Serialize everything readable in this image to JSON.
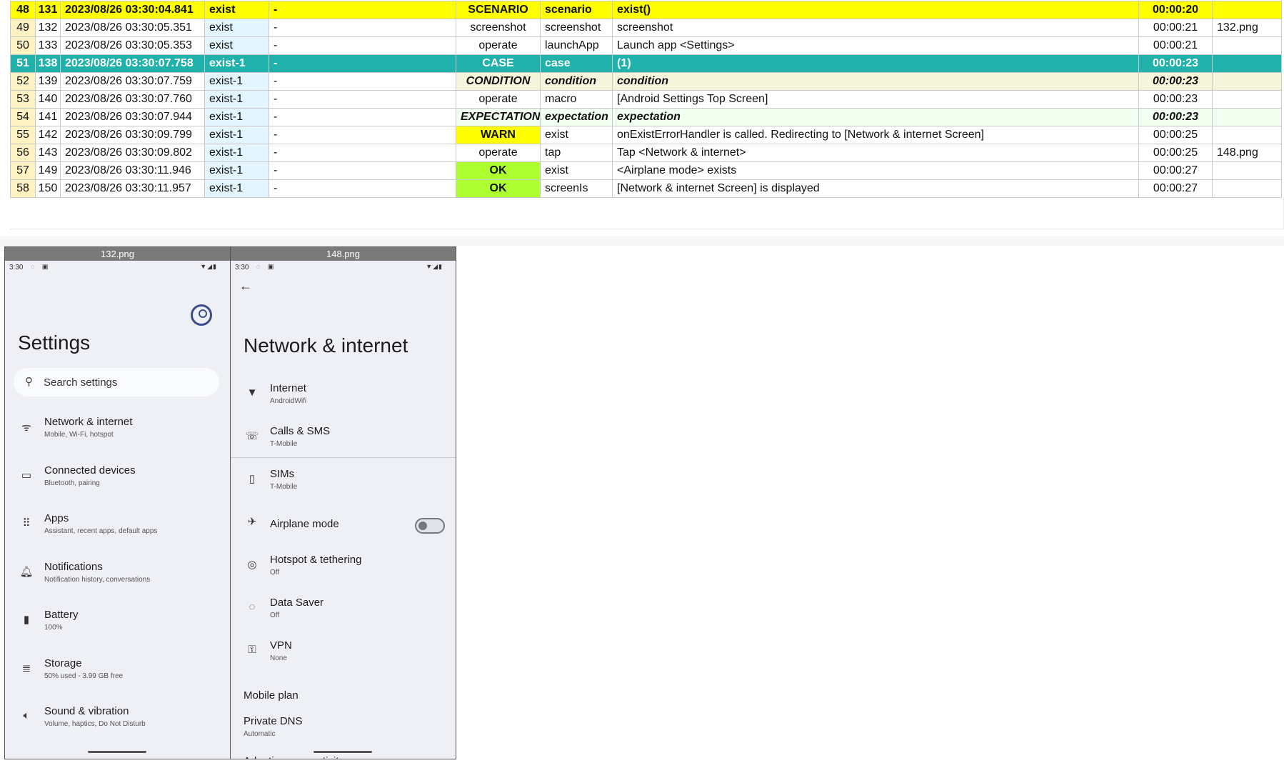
{
  "log_rows": [
    {
      "no": "48",
      "line": "131",
      "ts": "2023/08/26 03:30:04.841",
      "log": "exist",
      "group": "-",
      "type": "SCENARIO",
      "cmd": "scenario",
      "msg": "exist()",
      "time": "00:00:20",
      "file": "",
      "style": "scenario"
    },
    {
      "no": "49",
      "line": "132",
      "ts": "2023/08/26 03:30:05.351",
      "log": "exist",
      "group": "-",
      "type": "screenshot",
      "cmd": "screenshot",
      "msg": "screenshot",
      "time": "00:00:21",
      "file": "132.png",
      "style": ""
    },
    {
      "no": "50",
      "line": "133",
      "ts": "2023/08/26 03:30:05.353",
      "log": "exist",
      "group": "-",
      "type": "operate",
      "cmd": "launchApp",
      "msg": "Launch app <Settings>",
      "time": "00:00:21",
      "file": "",
      "style": ""
    },
    {
      "no": "51",
      "line": "138",
      "ts": "2023/08/26 03:30:07.758",
      "log": "exist-1",
      "group": "-",
      "type": "CASE",
      "cmd": "case",
      "msg": "(1)",
      "time": "00:00:23",
      "file": "",
      "style": "case"
    },
    {
      "no": "52",
      "line": "139",
      "ts": "2023/08/26 03:30:07.759",
      "log": "exist-1",
      "group": "-",
      "type": "CONDITION",
      "cmd": "condition",
      "msg": "condition",
      "time": "00:00:23",
      "file": "",
      "style": "condition"
    },
    {
      "no": "53",
      "line": "140",
      "ts": "2023/08/26 03:30:07.760",
      "log": "exist-1",
      "group": "-",
      "type": "operate",
      "cmd": "macro",
      "msg": "[Android Settings Top Screen]",
      "time": "00:00:23",
      "file": "",
      "style": ""
    },
    {
      "no": "54",
      "line": "141",
      "ts": "2023/08/26 03:30:07.944",
      "log": "exist-1",
      "group": "-",
      "type": "EXPECTATION",
      "cmd": "expectation",
      "msg": "expectation",
      "time": "00:00:23",
      "file": "",
      "style": "expectation"
    },
    {
      "no": "55",
      "line": "142",
      "ts": "2023/08/26 03:30:09.799",
      "log": "exist-1",
      "group": "-",
      "type": "WARN",
      "cmd": "exist",
      "msg": "onExistErrorHandler is called. Redirecting to [Network & internet Screen]",
      "time": "00:00:25",
      "file": "",
      "style": "warn"
    },
    {
      "no": "56",
      "line": "143",
      "ts": "2023/08/26 03:30:09.802",
      "log": "exist-1",
      "group": "-",
      "type": "operate",
      "cmd": "tap",
      "msg": "Tap <Network & internet>",
      "time": "00:00:25",
      "file": "148.png",
      "style": ""
    },
    {
      "no": "57",
      "line": "149",
      "ts": "2023/08/26 03:30:11.946",
      "log": "exist-1",
      "group": "-",
      "type": "OK",
      "cmd": "exist",
      "msg": "<Airplane mode> exists",
      "time": "00:00:27",
      "file": "",
      "style": "ok"
    },
    {
      "no": "58",
      "line": "150",
      "ts": "2023/08/26 03:30:11.957",
      "log": "exist-1",
      "group": "-",
      "type": "OK",
      "cmd": "screenIs",
      "msg": "[Network & internet Screen] is displayed",
      "time": "00:00:27",
      "file": "",
      "style": "ok"
    }
  ],
  "shot1": {
    "caption": "132.png",
    "clock": "3:30",
    "title": "Settings",
    "search_placeholder": "Search settings",
    "items": [
      {
        "icon": "wifi-icon",
        "glyph": "ᯤ",
        "title": "Network & internet",
        "sub": "Mobile, Wi-Fi, hotspot"
      },
      {
        "icon": "devices-icon",
        "glyph": "▭",
        "title": "Connected devices",
        "sub": "Bluetooth, pairing"
      },
      {
        "icon": "apps-icon",
        "glyph": "⠿",
        "title": "Apps",
        "sub": "Assistant, recent apps, default apps"
      },
      {
        "icon": "bell-icon",
        "glyph": "🔔︎",
        "title": "Notifications",
        "sub": "Notification history, conversations"
      },
      {
        "icon": "battery-icon",
        "glyph": "▮",
        "title": "Battery",
        "sub": "100%"
      },
      {
        "icon": "storage-icon",
        "glyph": "≣",
        "title": "Storage",
        "sub": "50% used - 3.99 GB free"
      },
      {
        "icon": "sound-icon",
        "glyph": "🔈︎",
        "title": "Sound & vibration",
        "sub": "Volume, haptics, Do Not Disturb"
      }
    ]
  },
  "shot2": {
    "caption": "148.png",
    "clock": "3:30",
    "title": "Network & internet",
    "items_top": [
      {
        "icon": "wifi-icon",
        "glyph": "▼",
        "title": "Internet",
        "sub": "AndroidWifi"
      },
      {
        "icon": "phone-icon",
        "glyph": "☏",
        "title": "Calls & SMS",
        "sub": "T-Mobile"
      }
    ],
    "items_bottom": [
      {
        "icon": "sim-icon",
        "glyph": "▯",
        "title": "SIMs",
        "sub": "T-Mobile"
      },
      {
        "icon": "airplane-icon",
        "glyph": "✈",
        "title": "Airplane mode",
        "sub": ""
      },
      {
        "icon": "hotspot-icon",
        "glyph": "◎",
        "title": "Hotspot & tethering",
        "sub": "Off"
      },
      {
        "icon": "data-saver-icon",
        "glyph": "◌",
        "title": "Data Saver",
        "sub": "Off"
      },
      {
        "icon": "vpn-icon",
        "glyph": "⚿",
        "title": "VPN",
        "sub": "None"
      }
    ],
    "plain_items": [
      {
        "title": "Mobile plan",
        "sub": ""
      },
      {
        "title": "Private DNS",
        "sub": "Automatic"
      },
      {
        "title": "Adaptive connectivity",
        "sub": ""
      }
    ]
  }
}
